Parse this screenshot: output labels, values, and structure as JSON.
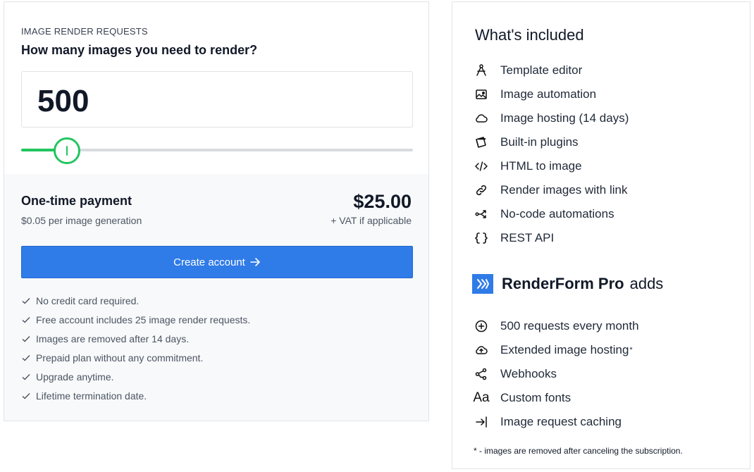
{
  "render": {
    "eyebrow": "IMAGE RENDER REQUESTS",
    "question": "How many images you need to render?",
    "count": "500",
    "slider_fraction": 0.115,
    "accent_color": "#22c55e"
  },
  "payment": {
    "title": "One-time payment",
    "per_image": "$0.05 per image generation",
    "price": "$25.00",
    "vat": "+ VAT if applicable",
    "cta_label": "Create account",
    "cta_icon": "arrow-right-icon",
    "cta_color": "#2f7be8"
  },
  "checks": [
    "No credit card required.",
    "Free account includes 25 image render requests.",
    "Images are removed after 14 days.",
    "Prepaid plan without any commitment.",
    "Upgrade anytime.",
    "Lifetime termination date."
  ],
  "included": {
    "title": "What's included",
    "items": [
      {
        "label": "Template editor",
        "icon": "compass-icon"
      },
      {
        "label": "Image automation",
        "icon": "image-icon"
      },
      {
        "label": "Image hosting (14 days)",
        "icon": "cloud-icon"
      },
      {
        "label": "Built-in plugins",
        "icon": "plugin-icon"
      },
      {
        "label": "HTML to image",
        "icon": "code-icon"
      },
      {
        "label": "Render images with link",
        "icon": "link-icon"
      },
      {
        "label": "No-code automations",
        "icon": "split-arrow-icon"
      },
      {
        "label": "REST API",
        "icon": "braces-icon"
      }
    ]
  },
  "pro": {
    "brand": "RenderForm Pro",
    "adds": "adds",
    "items": [
      {
        "label": "500 requests every month",
        "icon": "plus-circle-icon"
      },
      {
        "label": "Extended image hosting",
        "icon": "cloud-upload-icon",
        "asterisk": "*"
      },
      {
        "label": "Webhooks",
        "icon": "webhook-icon"
      },
      {
        "label": "Custom fonts",
        "icon": "font-icon",
        "glyph": "Aa"
      },
      {
        "label": "Image request caching",
        "icon": "arrow-in-icon"
      }
    ],
    "footnote": "* - images are removed after canceling the subscription."
  }
}
